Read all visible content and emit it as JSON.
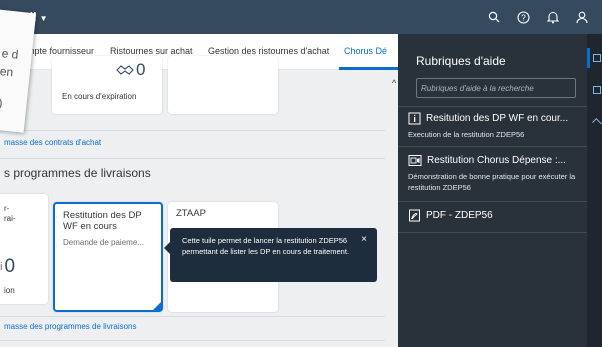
{
  "shell": {
    "title": "ccueil",
    "icons": [
      "search-icon",
      "help-icon",
      "bell-icon",
      "user-icon"
    ],
    "bg_color": "#354a5f"
  },
  "tabs": [
    "ompte fournisseur",
    "Ristournes sur achat",
    "Gestion des ristournes d'achat",
    "Chorus Dé"
  ],
  "main": {
    "tile_expiring": {
      "count": "0",
      "label": "En cours d'expiration"
    },
    "link_contracts": "masse des contrats d'achat",
    "section_title": "s programmes de livraisons",
    "tile_left_partial": {
      "line1": "r-",
      "line2": "rai-",
      "count": "0",
      "footer": "ion"
    },
    "tile_restitution": {
      "title_line1": "Restitution des DP",
      "title_line2": "WF en cours",
      "subtitle": "Demande de paieme..."
    },
    "tile_ztaap": {
      "title": "ZTAAP"
    },
    "link_programs": "masse des programmes de livraisons"
  },
  "tooltip": {
    "text": "Cette tuile permet de lancer la restitution ZDEP56 permettant de lister les DP en cours de traitement.",
    "close": "×"
  },
  "sheet": {
    "frag1": "e d",
    "frag2": "en",
    "frag3": ")"
  },
  "help": {
    "title": "Rubriques d'aide",
    "search_placeholder": "Rubriques d'aide à la recherche",
    "items": [
      {
        "title": "Resitution des DP WF en cour...",
        "desc": "Execution de la restitution ZDEP56",
        "icon": "info-icon"
      },
      {
        "title": "Restitution Chorus Dépense :...",
        "desc": "Démonstration de bonne pratique pour exécuter la restitution ZDEP56",
        "icon": "video-icon"
      },
      {
        "title": "PDF - ZDEP56",
        "desc": "",
        "icon": "pdf-icon"
      }
    ],
    "accent": "#0a6ed1"
  }
}
